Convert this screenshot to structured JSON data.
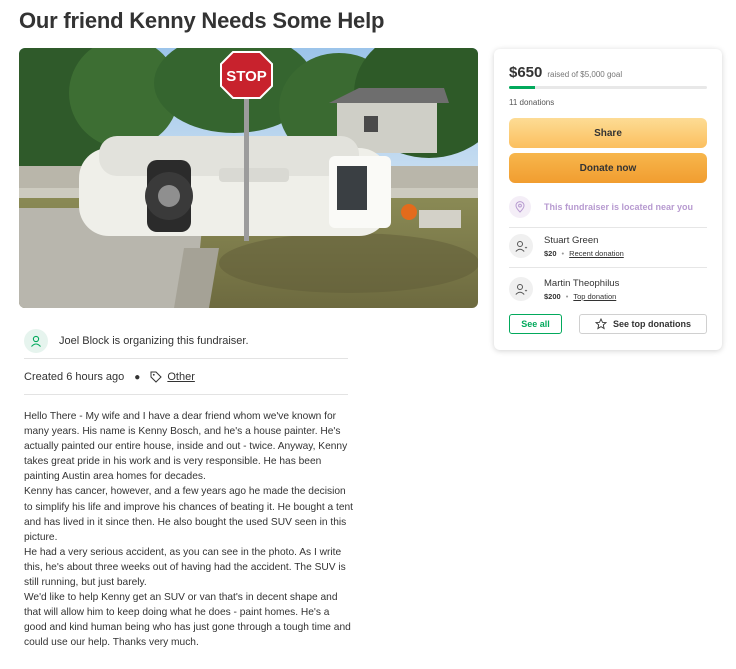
{
  "page": {
    "title": "Our friend Kenny Needs Some Help"
  },
  "organizer": {
    "text": "Joel Block is organizing this fundraiser."
  },
  "meta": {
    "created": "Created 6 hours ago",
    "category": "Other",
    "icon": "tag-icon"
  },
  "story": {
    "paragraphs": [
      "Hello There - My wife and I have a dear friend whom we've known for many years. His name is Kenny Bosch, and he's a house painter. He's actually painted our entire house, inside and out - twice. Anyway, Kenny takes great pride in his work and is very responsible. He has been painting Austin area homes for decades.",
      "Kenny has cancer, however, and a few years ago he made the decision to simplify his life and improve his chances of beating it. He bought a tent and has lived in it since then. He also bought the used SUV seen in this picture.",
      "He had a very serious accident, as you can see in the photo. As I write this, he's about three weeks out of having had the accident. The SUV is still running, but just barely.",
      "We'd like to help Kenny get an SUV or van that's in decent shape and that will allow him to keep doing what he does - paint homes. He's a good and kind human being who has just gone through a tough time and could use our help. Thanks very much."
    ]
  },
  "hero": {
    "sign_text": "STOP"
  },
  "donation_card": {
    "raised": "$650",
    "goal_text": "raised of $5,000 goal",
    "progress_fraction": 0.13,
    "donations_count": "11 donations",
    "share_label": "Share",
    "donate_label": "Donate now",
    "location_text": "This fundraiser is located near you",
    "donors": [
      {
        "name": "Stuart Green",
        "amount": "$20",
        "note": "Recent donation"
      },
      {
        "name": "Martin Theophilus",
        "amount": "$200",
        "note": "Top donation"
      }
    ],
    "see_all_label": "See all",
    "see_top_label": "See top donations"
  },
  "colors": {
    "brand_green": "#02a95c",
    "share_yellow": "#fbbf5e",
    "donate_orange": "#f19d30",
    "location_purple": "#b79ad0"
  }
}
